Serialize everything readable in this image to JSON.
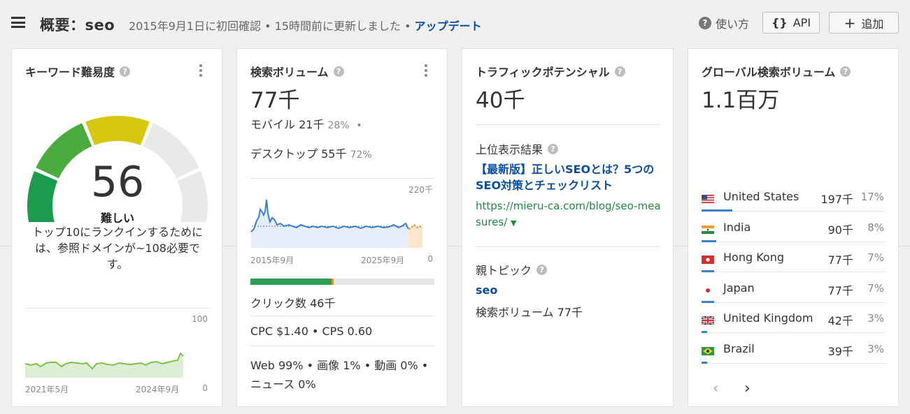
{
  "header": {
    "title": "概要：seo",
    "meta": "2015年9月1日に初回確認 • 15時間前に更新しました •",
    "update_link": "アップデート",
    "help_label": "使い方",
    "api_label": "API",
    "add_label": "追加"
  },
  "kd": {
    "title": "キーワード難易度",
    "score": "56",
    "level": "難しい",
    "description": "トップ10にランクインするためには、参照ドメインが~108必要です。",
    "chart_max": "100",
    "chart_min": "0",
    "x_start": "2021年5月",
    "x_end": "2024年9月",
    "gauge_value": 56
  },
  "volume": {
    "title": "検索ボリューム",
    "value": "77千",
    "mobile_label": "モバイル 21千",
    "mobile_pct": "28%",
    "desktop_label": "デスクトップ 55千",
    "desktop_pct": "72%",
    "chart_max": "220千",
    "chart_min": "0",
    "x_start": "2015年9月",
    "x_end": "2025年9月",
    "clicks": "クリック数 46千",
    "clicks_paid_fraction": 0.01,
    "clicks_organic_fraction": 0.44,
    "cpc_cps": "CPC $1.40 • CPS 0.60",
    "serp_types": "Web 99% • 画像 1% • 動画 0% • ニュース 0%"
  },
  "traffic": {
    "title": "トラフィックポテンシャル",
    "value": "40千",
    "top_result_label": "上位表示結果",
    "top_result_title": "【最新版】正しいSEOとは？5つのSEO対策とチェックリスト",
    "top_result_url": "https://mieru-ca.com/blog/seo-measures/",
    "parent_topic_label": "親トピック",
    "parent_topic": "seo",
    "parent_volume": "検索ボリューム 77千"
  },
  "global": {
    "title": "グローバル検索ボリューム",
    "value": "1.1百万",
    "countries": [
      {
        "name": "United States",
        "volume": "197千",
        "pct": "17%",
        "share": 0.17,
        "flag": "us-flag-icon"
      },
      {
        "name": "India",
        "volume": "90千",
        "pct": "8%",
        "share": 0.08,
        "flag": "in-flag-icon"
      },
      {
        "name": "Hong Kong",
        "volume": "77千",
        "pct": "7%",
        "share": 0.07,
        "flag": "hk-flag-icon"
      },
      {
        "name": "Japan",
        "volume": "77千",
        "pct": "7%",
        "share": 0.07,
        "flag": "jp-flag-icon"
      },
      {
        "name": "United Kingdom",
        "volume": "42千",
        "pct": "3%",
        "share": 0.03,
        "flag": "gb-flag-icon"
      },
      {
        "name": "Brazil",
        "volume": "39千",
        "pct": "3%",
        "share": 0.03,
        "flag": "br-flag-icon"
      }
    ]
  },
  "colors": {
    "link": "#0a4ea3",
    "url_green": "#1c8a40",
    "volume_line": "#3a7fd0",
    "kd_line": "#7cc242"
  }
}
